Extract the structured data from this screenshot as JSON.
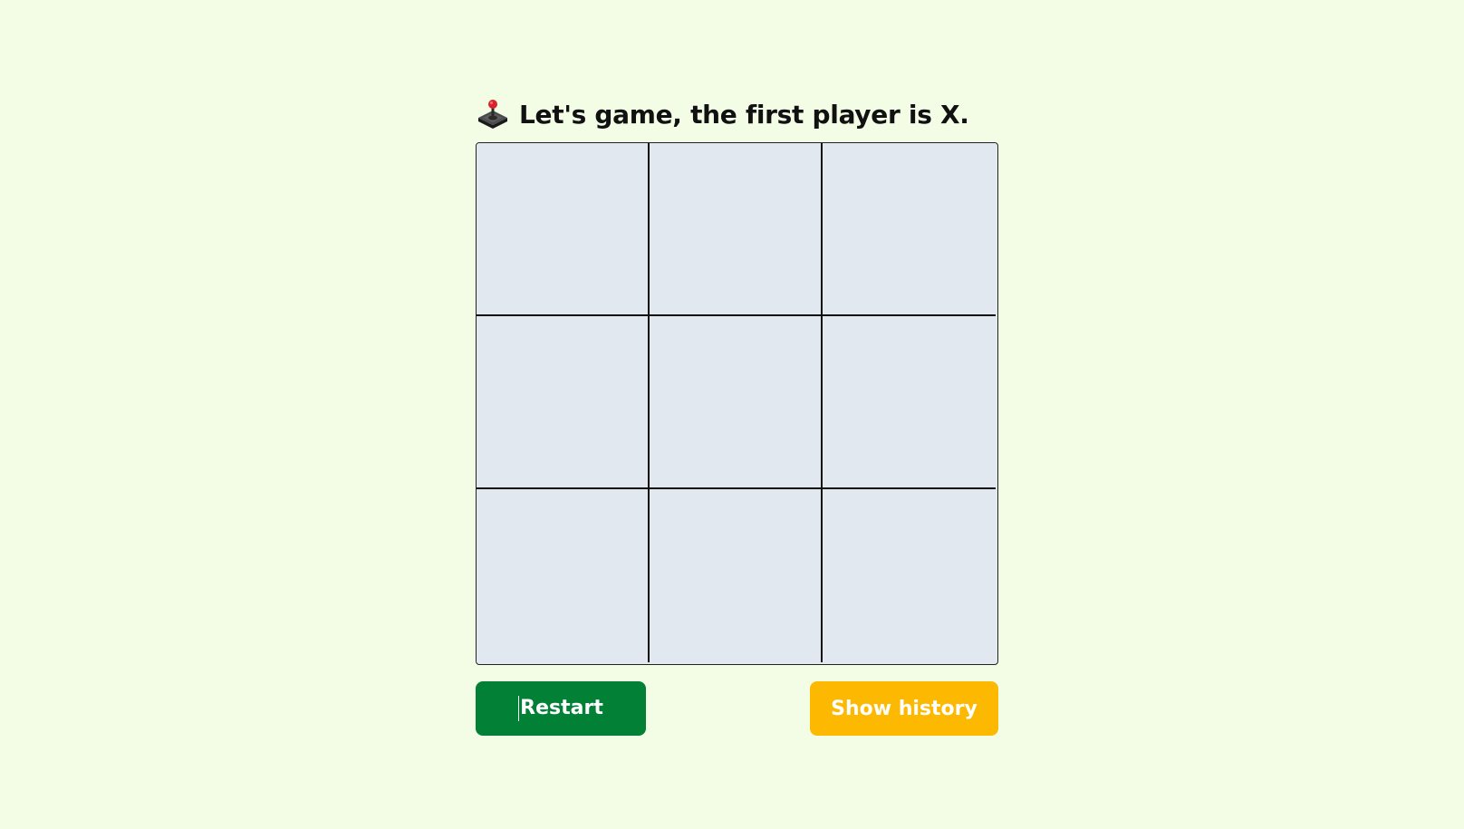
{
  "status": {
    "icon": "joystick-icon",
    "text": "Let's game, the first player is X."
  },
  "board": {
    "cells": [
      "",
      "",
      "",
      "",
      "",
      "",
      "",
      "",
      ""
    ]
  },
  "controls": {
    "restart_label": "Restart",
    "history_label": "Show history"
  },
  "colors": {
    "background": "#f3fde6",
    "cell": "#e1e8f0",
    "restart": "#028035",
    "history": "#fdb901"
  }
}
